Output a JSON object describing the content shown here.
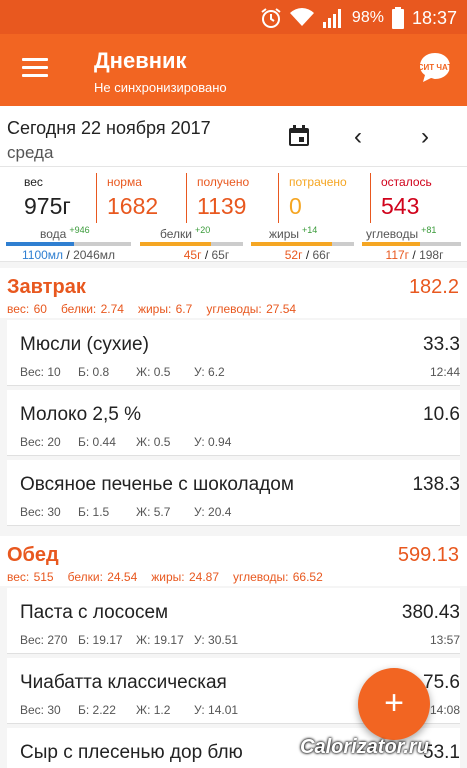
{
  "status": {
    "battery": "98%",
    "time": "18:37"
  },
  "app": {
    "title": "Дневник",
    "subtitle": "Не синхронизировано",
    "chat_label": "СИТ ЧАТ"
  },
  "date": {
    "day": "Сегодня 22 ноября 2017",
    "weekday": "среда"
  },
  "summary": {
    "stats": [
      {
        "label": "вес",
        "value": "975г",
        "color": "#222222"
      },
      {
        "label": "норма",
        "value": "1682",
        "color": "#e8581f"
      },
      {
        "label": "получено",
        "value": "1139",
        "color": "#e8581f"
      },
      {
        "label": "потрачено",
        "value": "0",
        "color": "#f5a623"
      },
      {
        "label": "осталось",
        "value": "543",
        "color": "#d0021b"
      }
    ],
    "bars": [
      {
        "label": "вода",
        "delta": "+946",
        "have": "1100мл",
        "norm": "2046мл",
        "fill": 0.54,
        "color": "#2f7fd1"
      },
      {
        "label": "белки",
        "delta": "+20",
        "have": "45г",
        "norm": "65г",
        "fill": 0.69,
        "color": "#f5a623"
      },
      {
        "label": "жиры",
        "delta": "+14",
        "have": "52г",
        "norm": "66г",
        "fill": 0.79,
        "color": "#f5a623"
      },
      {
        "label": "углеводы",
        "delta": "+81",
        "have": "117г",
        "norm": "198г",
        "fill": 0.59,
        "color": "#f5a623"
      }
    ]
  },
  "meals": [
    {
      "name": "Завтрак",
      "total": "182.2",
      "weight": "вес: 60",
      "protein": "белки: 2.74",
      "fat": "жиры: 6.7",
      "carbs": "углеводы: 27.54",
      "items": [
        {
          "name": "Мюсли (сухие)",
          "kcal": "33.3",
          "w": "Вес: 10",
          "p": "Б: 0.8",
          "f": "Ж: 0.5",
          "c": "У: 6.2",
          "time": "12:44"
        },
        {
          "name": "Молоко 2,5 %",
          "kcal": "10.6",
          "w": "Вес: 20",
          "p": "Б: 0.44",
          "f": "Ж: 0.5",
          "c": "У: 0.94",
          "time": ""
        },
        {
          "name": "Овсяное печенье с шоколадом",
          "kcal": "138.3",
          "w": "Вес: 30",
          "p": "Б: 1.5",
          "f": "Ж: 5.7",
          "c": "У: 20.4",
          "time": ""
        }
      ]
    },
    {
      "name": "Обед",
      "total": "599.13",
      "weight": "вес: 515",
      "protein": "белки: 24.54",
      "fat": "жиры: 24.87",
      "carbs": "углеводы: 66.52",
      "items": [
        {
          "name": "Паста с лососем",
          "kcal": "380.43",
          "w": "Вес: 270",
          "p": "Б: 19.17",
          "f": "Ж: 19.17",
          "c": "У: 30.51",
          "time": "13:57"
        },
        {
          "name": "Чиабатта классическая",
          "kcal": "75.6",
          "w": "Вес: 30",
          "p": "Б: 2.22",
          "f": "Ж: 1.2",
          "c": "У: 14.01",
          "time": "14:08"
        },
        {
          "name": "Сыр с плесенью дор блю",
          "kcal": "53.1",
          "w": "",
          "p": "",
          "f": "",
          "c": "",
          "time": ""
        }
      ]
    }
  ],
  "fab": {
    "label": "+"
  },
  "watermark": "Calorizator.ru"
}
